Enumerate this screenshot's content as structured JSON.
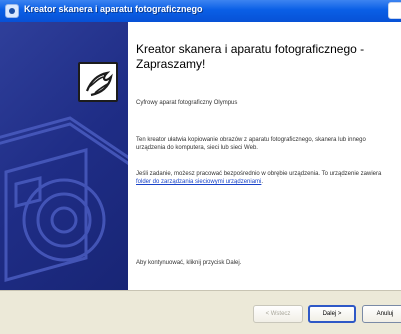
{
  "window": {
    "title": "Kreator skanera i aparatu fotograficznego",
    "title_icon": "camera-wizard-icon",
    "close_icon": "close-icon"
  },
  "sidebar": {
    "icon": "wizard-logo-icon",
    "art": "camera-illustration"
  },
  "content": {
    "heading": "Kreator skanera i aparatu fotograficznego - Zapraszamy!",
    "subtitle": "Cyfrowy aparat fotograficzny Olympus",
    "para1": "Ten kreator ułatwia kopiowanie obrazów z aparatu fotograficznego, skanera lub innego urządzenia do komputera, sieci lub sieci Web.",
    "para2_before": "Jeśli zadanie, możesz pracować bezpośrednio w obrębie urządzenia. To urządzenie zawiera ",
    "para2_link": "folder do zarządzania sieciowymi urządzeniami",
    "para2_after": ".",
    "continue_text": "Aby kontynuować, kliknij przycisk Dalej."
  },
  "footer": {
    "back_label": "< Wstecz",
    "next_label": "Dalej >",
    "cancel_label": "Anuluj"
  },
  "colors": {
    "titlebar": "#0a5fe6",
    "sidebar": "#1f2d86",
    "link": "#1842c8",
    "footer": "#ece9d8"
  }
}
